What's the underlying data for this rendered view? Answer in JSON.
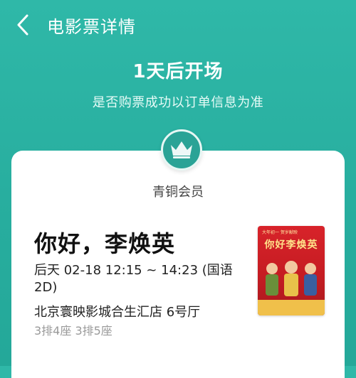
{
  "header": {
    "title": "电影票详情",
    "back_icon": "chevron-left-icon"
  },
  "status": {
    "title": "1天后开场",
    "subtitle": "是否购票成功以订单信息为准"
  },
  "member": {
    "label": "青铜会员",
    "icon": "crown-icon"
  },
  "movie": {
    "title": "你好，李焕英",
    "showtime": "后天 02-18 12:15 ~ 14:23 (国语 2D)",
    "cinema": "北京寰映影城合生汇店 6号厅",
    "seats": "3排4座 3排5座",
    "poster": {
      "top_text": "大年初一 贺岁献映",
      "brand": "你好李焕英"
    }
  },
  "colors": {
    "bg": "#2fb8a8",
    "card": "#ffffff",
    "badge": "#2aa396",
    "poster": "#d8232a"
  }
}
